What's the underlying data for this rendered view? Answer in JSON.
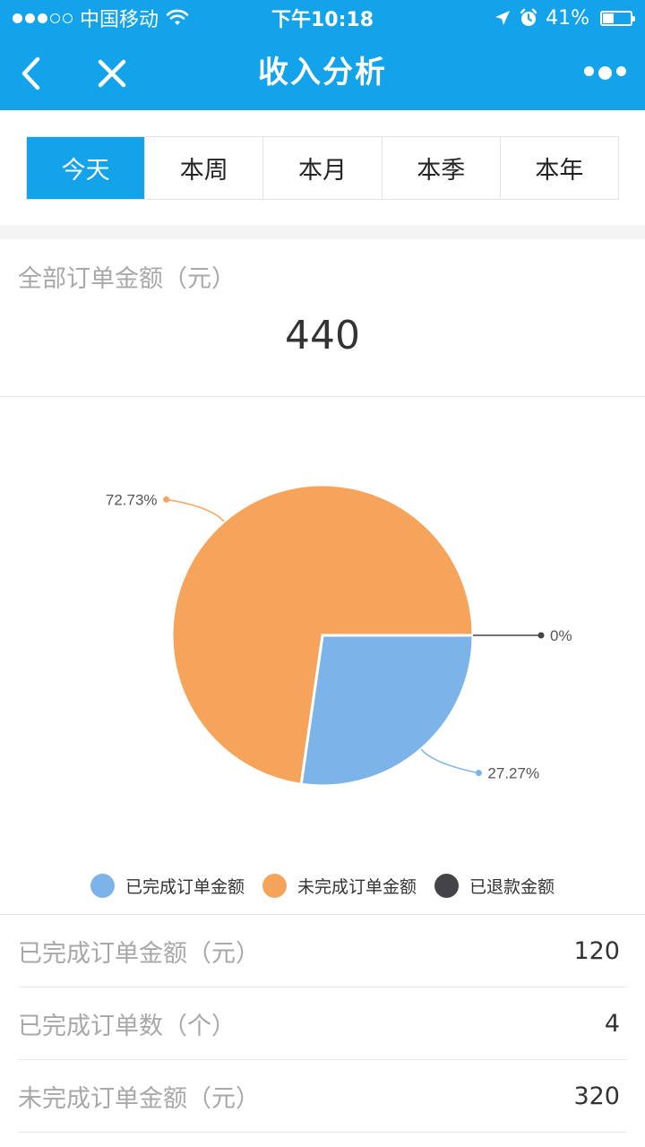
{
  "status_bar": {
    "carrier": "中国移动",
    "time": "下午10:18",
    "battery": "41%",
    "battery_level": 0.41
  },
  "nav": {
    "title": "收入分析"
  },
  "tabs": [
    {
      "label": "今天",
      "active": true
    },
    {
      "label": "本周",
      "active": false
    },
    {
      "label": "本月",
      "active": false
    },
    {
      "label": "本季",
      "active": false
    },
    {
      "label": "本年",
      "active": false
    }
  ],
  "total": {
    "label": "全部订单金额（元）",
    "value": "440"
  },
  "chart_data": {
    "type": "pie",
    "slices": [
      {
        "name": "已完成订单金额",
        "value": 27.27,
        "label": "27.27%",
        "color": "#7cb4ea"
      },
      {
        "name": "未完成订单金额",
        "value": 72.73,
        "label": "72.73%",
        "color": "#f6a45c"
      },
      {
        "name": "已退款金额",
        "value": 0,
        "label": "0%",
        "color": "#434348"
      }
    ],
    "legend_position": "bottom"
  },
  "stats": [
    {
      "label": "已完成订单金额（元）",
      "value": "120"
    },
    {
      "label": "已完成订单数（个）",
      "value": "4"
    },
    {
      "label": "未完成订单金额（元）",
      "value": "320"
    }
  ]
}
